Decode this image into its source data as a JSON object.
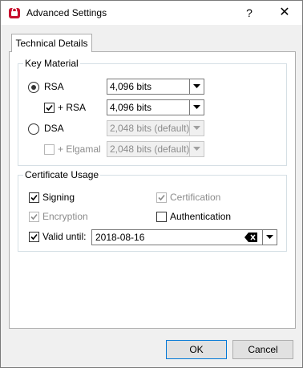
{
  "window": {
    "title": "Advanced Settings",
    "help": "?",
    "close": "✕"
  },
  "tabs": [
    {
      "label": "Technical Details",
      "active": true
    }
  ],
  "key_material": {
    "legend": "Key Material",
    "rsa": {
      "label": "RSA",
      "selected": true,
      "bits": "4,096 bits"
    },
    "rsa_sub": {
      "label": "+ RSA",
      "checked": true,
      "bits": "4,096 bits"
    },
    "dsa": {
      "label": "DSA",
      "selected": false,
      "bits": "2,048 bits (default)"
    },
    "elgamal": {
      "label": "+ Elgamal",
      "checked": false,
      "bits": "2,048 bits (default)"
    }
  },
  "cert_usage": {
    "legend": "Certificate Usage",
    "signing": {
      "label": "Signing",
      "checked": true
    },
    "certification": {
      "label": "Certification",
      "checked": true,
      "disabled": true
    },
    "encryption": {
      "label": "Encryption",
      "checked": true,
      "disabled": true
    },
    "authentication": {
      "label": "Authentication",
      "checked": false
    },
    "valid_until": {
      "label": "Valid until:",
      "checked": true,
      "date": "2018-08-16"
    }
  },
  "buttons": {
    "ok": "OK",
    "cancel": "Cancel"
  },
  "colors": {
    "accent": "#0078d7",
    "icon_red": "#c8102e"
  }
}
